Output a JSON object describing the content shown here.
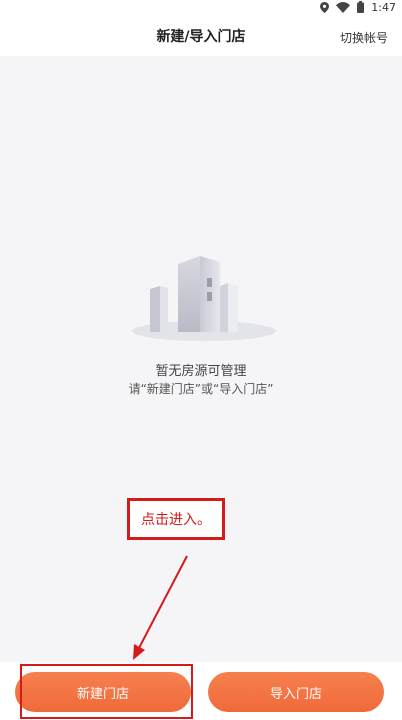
{
  "status_bar": {
    "time": "1:47",
    "icons": [
      "location-icon",
      "wifi-icon",
      "battery-icon"
    ]
  },
  "header": {
    "title": "新建/导入门店",
    "switch_account": "切换帐号"
  },
  "empty_state": {
    "title": "暂无房源可管理",
    "hint": "请“新建门店”或“导入门店”",
    "icon": "buildings-illustration"
  },
  "annotation": {
    "callout_text": "点击进入。",
    "color": "#d41a1a"
  },
  "footer": {
    "new_store_label": "新建门店",
    "import_store_label": "导入门店",
    "button_color": "#f06a3a"
  }
}
